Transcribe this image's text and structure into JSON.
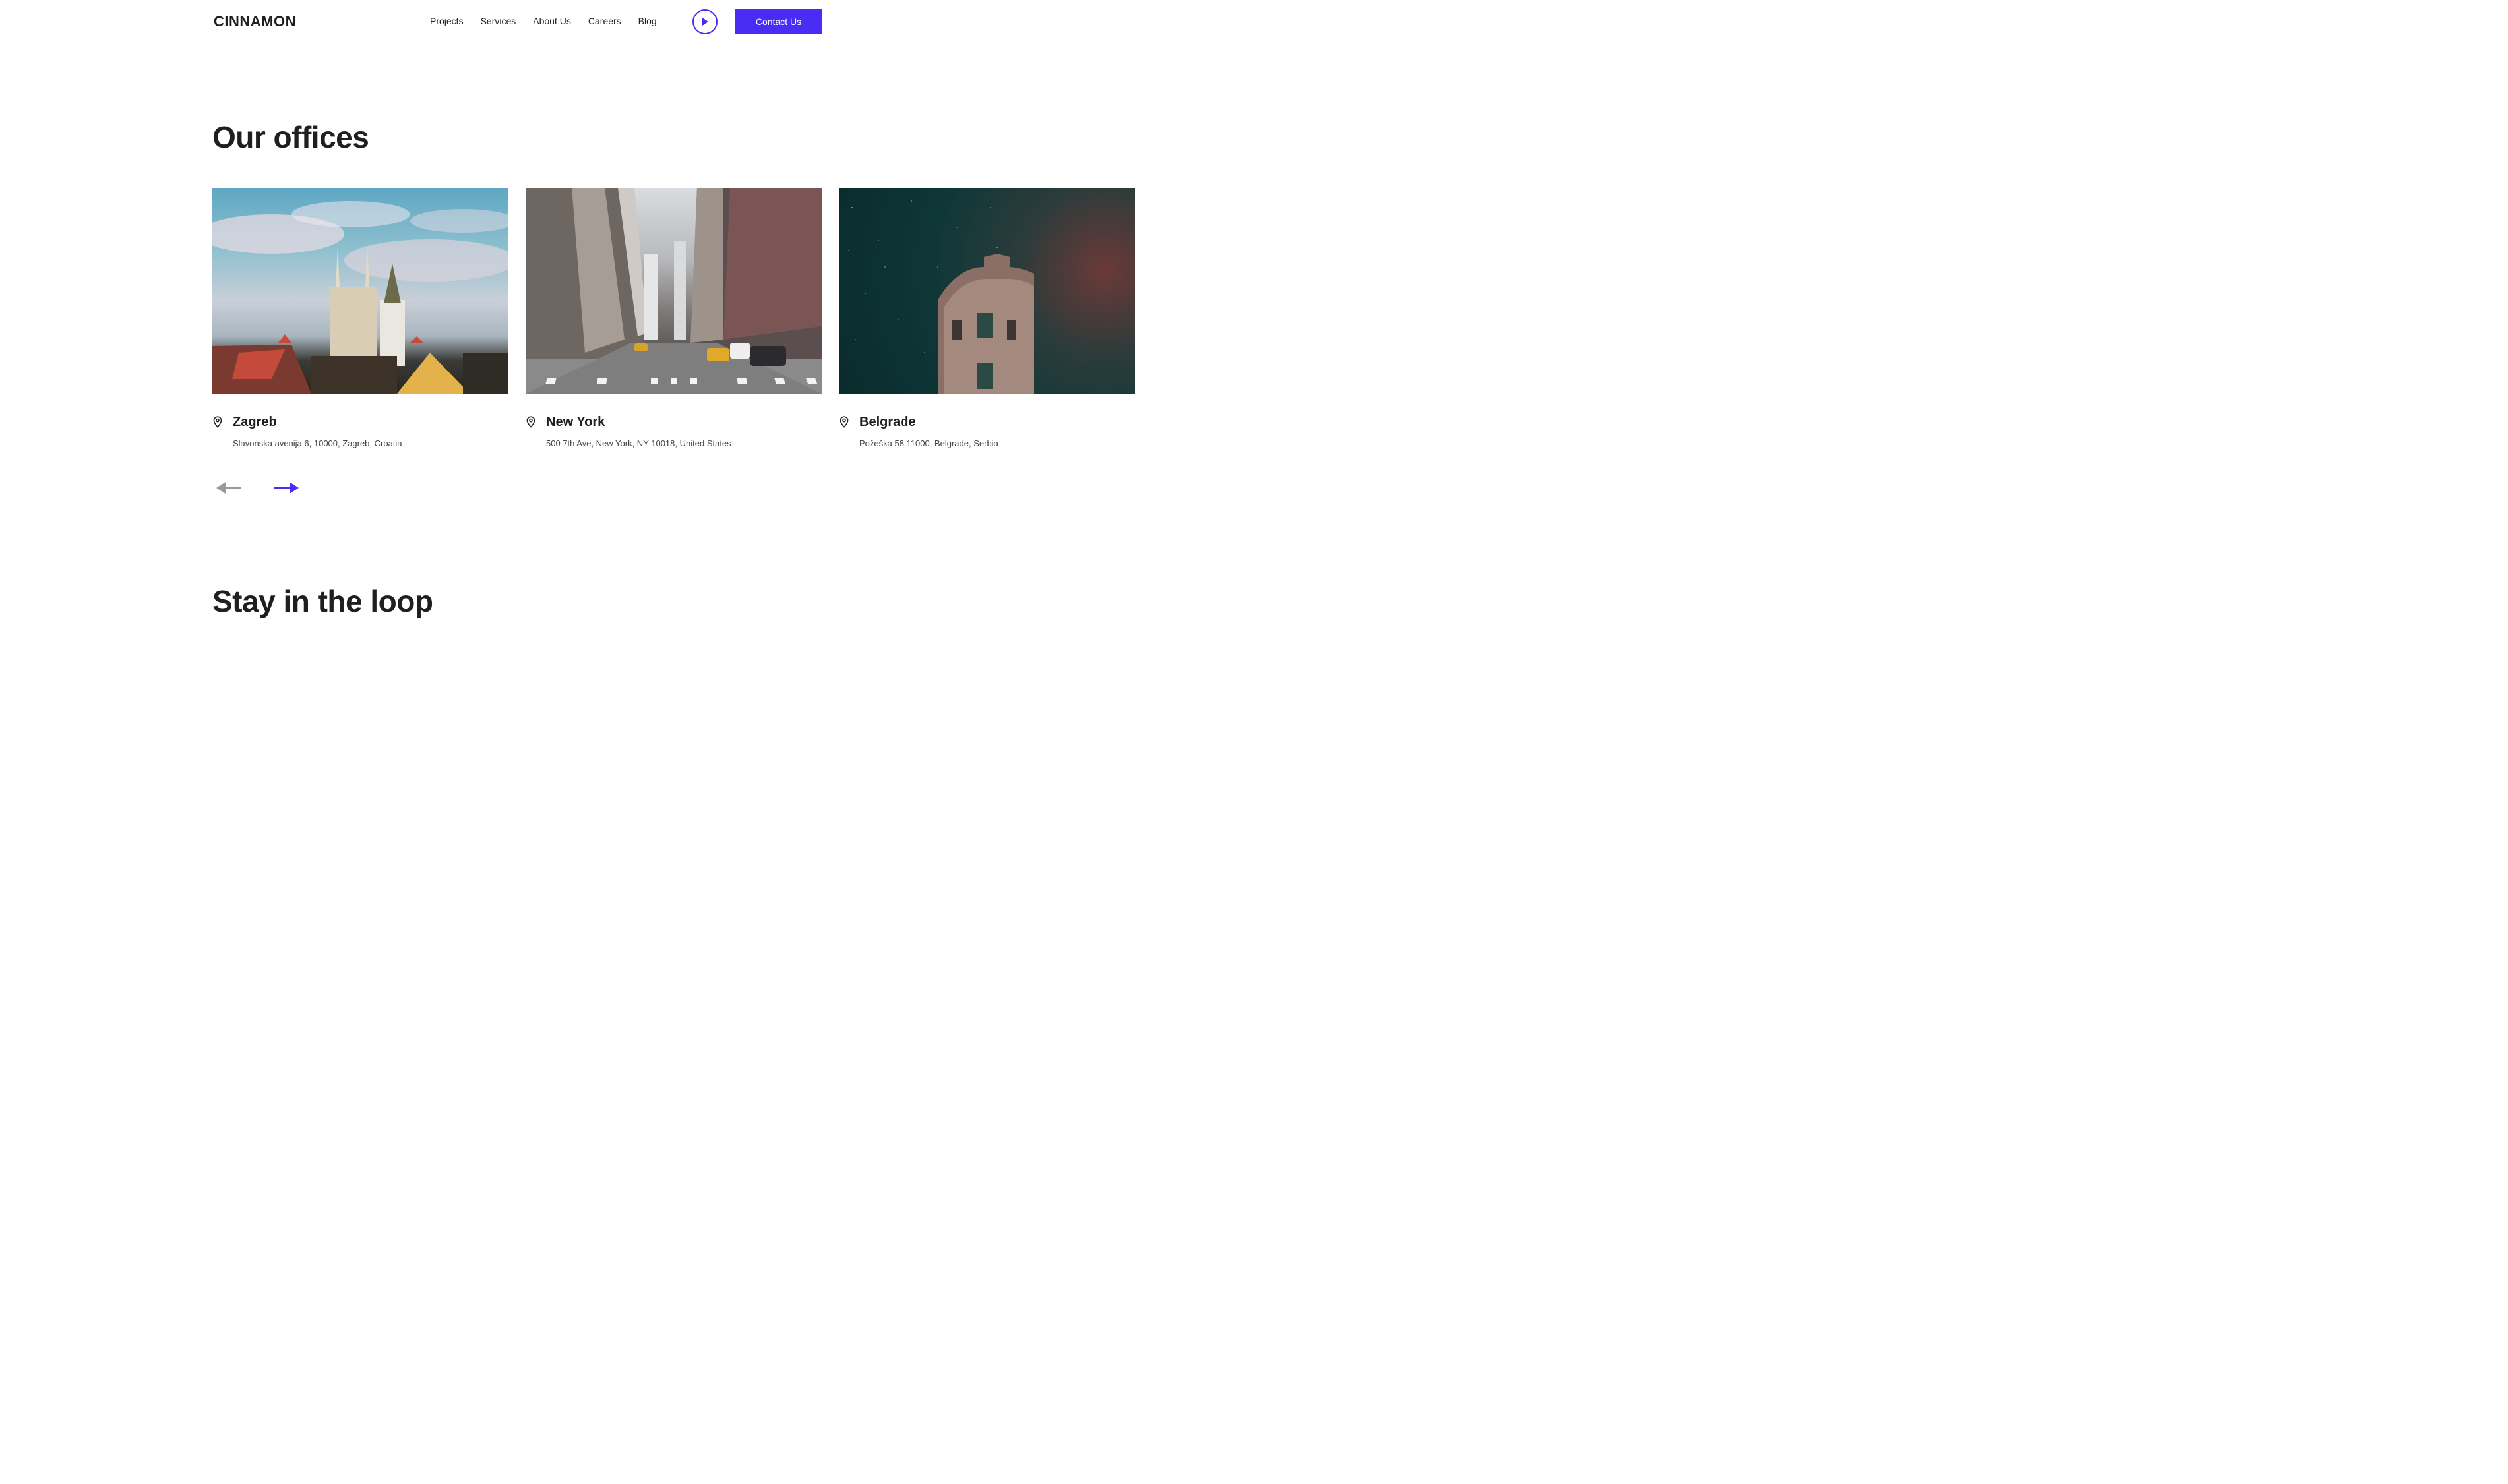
{
  "header": {
    "logo": "CINNAMON",
    "nav": [
      "Projects",
      "Services",
      "About Us",
      "Careers",
      "Blog"
    ],
    "play_icon": "play-icon",
    "contact_label": "Contact Us"
  },
  "offices_section": {
    "title": "Our offices",
    "offices": [
      {
        "city": "Zagreb",
        "address": "Slavonska avenija 6, 10000, Zagreb, Croatia",
        "icon": "location-pin-icon"
      },
      {
        "city": "New York",
        "address": "500 7th Ave, New York, NY 10018, United States",
        "icon": "location-pin-icon"
      },
      {
        "city": "Belgrade",
        "address": "Požeška 58 11000, Belgrade, Serbia",
        "icon": "location-pin-icon"
      }
    ],
    "prev_icon": "arrow-left-icon",
    "next_icon": "arrow-right-icon"
  },
  "newsletter_section": {
    "title": "Stay in the loop"
  },
  "colors": {
    "accent": "#4a2cf5",
    "text": "#1f1f1f",
    "muted_arrow": "#9a9a9a"
  }
}
